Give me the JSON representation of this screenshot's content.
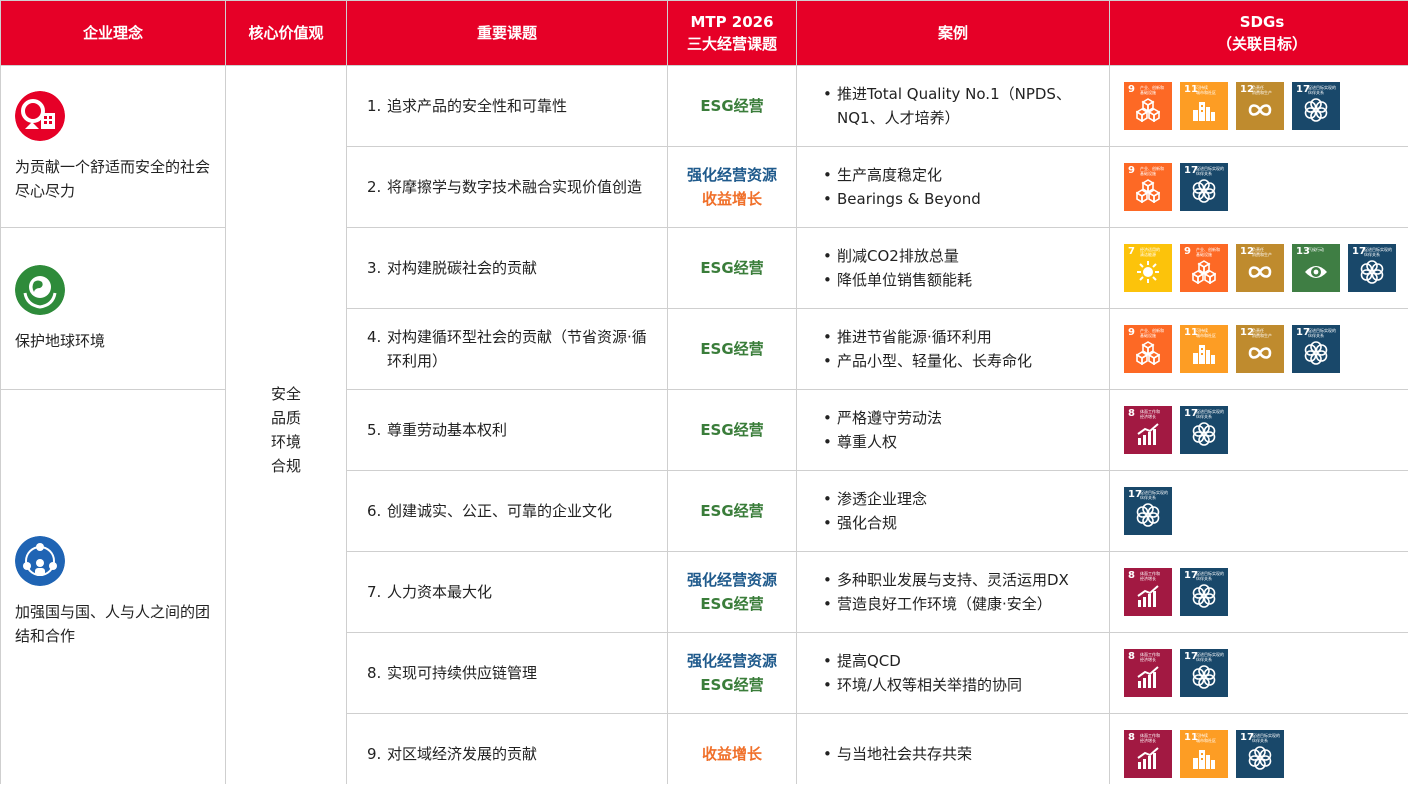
{
  "headers": {
    "philosophy": "企业理念",
    "values": "核心价值观",
    "topics": "重要课题",
    "mtp_line1": "MTP 2026",
    "mtp_line2": "三大经营课题",
    "cases": "案例",
    "sdgs_line1": "SDGs",
    "sdgs_line2": "（关联目标）"
  },
  "philosophies": [
    {
      "text": "为贡献一个舒适而安全的社会尽心尽力",
      "icon": "lifebuoy-house-icon",
      "color": "#e60027"
    },
    {
      "text": "保护地球环境",
      "icon": "earth-hands-icon",
      "color": "#2e8b3a"
    },
    {
      "text": "加强国与国、人与人之间的团结和合作",
      "icon": "people-circle-icon",
      "color": "#1f64b4"
    }
  ],
  "core_values": [
    "安全",
    "品质",
    "环境",
    "合规"
  ],
  "topics": [
    {
      "num": "1.",
      "text": "追求产品的安全性和可靠性",
      "mtp": [
        {
          "label": "ESG经营",
          "color": "green"
        }
      ],
      "cases": [
        "推进Total Quality No.1（NPDS、NQ1、人才培养）"
      ],
      "sdgs": [
        9,
        11,
        12,
        17
      ]
    },
    {
      "num": "2.",
      "text": "将摩擦学与数字技术融合实现价值创造",
      "mtp": [
        {
          "label": "强化经营资源",
          "color": "blue"
        },
        {
          "label": "收益增长",
          "color": "orange"
        }
      ],
      "cases": [
        "生产高度稳定化",
        "Bearings & Beyond"
      ],
      "sdgs": [
        9,
        17
      ]
    },
    {
      "num": "3.",
      "text": "对构建脱碳社会的贡献",
      "mtp": [
        {
          "label": "ESG经营",
          "color": "green"
        }
      ],
      "cases": [
        "削减CO2排放总量",
        "降低单位销售额能耗"
      ],
      "sdgs": [
        7,
        9,
        12,
        13,
        17
      ]
    },
    {
      "num": "4.",
      "text": "对构建循环型社会的贡献（节省资源·循环利用）",
      "mtp": [
        {
          "label": "ESG经营",
          "color": "green"
        }
      ],
      "cases": [
        "推进节省能源·循环利用",
        "产品小型、轻量化、长寿命化"
      ],
      "sdgs": [
        9,
        11,
        12,
        17
      ]
    },
    {
      "num": "5.",
      "text": "尊重劳动基本权利",
      "mtp": [
        {
          "label": "ESG经营",
          "color": "green"
        }
      ],
      "cases": [
        "严格遵守劳动法",
        "尊重人权"
      ],
      "sdgs": [
        8,
        17
      ]
    },
    {
      "num": "6.",
      "text": "创建诚实、公正、可靠的企业文化",
      "mtp": [
        {
          "label": "ESG经营",
          "color": "green"
        }
      ],
      "cases": [
        "渗透企业理念",
        "强化合规"
      ],
      "sdgs": [
        17
      ]
    },
    {
      "num": "7.",
      "text": "人力资本最大化",
      "mtp": [
        {
          "label": "强化经营资源",
          "color": "blue"
        },
        {
          "label": "ESG经营",
          "color": "green"
        }
      ],
      "cases": [
        "多种职业发展与支持、灵活运用DX",
        "营造良好工作环境（健康·安全）"
      ],
      "sdgs": [
        8,
        17
      ]
    },
    {
      "num": "8.",
      "text": "实现可持续供应链管理",
      "mtp": [
        {
          "label": "强化经营资源",
          "color": "blue"
        },
        {
          "label": "ESG经营",
          "color": "green"
        }
      ],
      "cases": [
        "提高QCD",
        "环境/人权等相关举措的协同"
      ],
      "sdgs": [
        8,
        17
      ]
    },
    {
      "num": "9.",
      "text": "对区域经济发展的贡献",
      "mtp": [
        {
          "label": "收益增长",
          "color": "orange"
        }
      ],
      "cases": [
        "与当地社会共存共荣"
      ],
      "sdgs": [
        8,
        11,
        17
      ]
    }
  ],
  "sdg_defs": {
    "7": {
      "color": "#fcc30b",
      "label": "经济适用的\n清洁能源",
      "icon": "sun-icon"
    },
    "8": {
      "color": "#a21942",
      "label": "体面工作和\n经济增长",
      "icon": "growth-chart-icon"
    },
    "9": {
      "color": "#fd6925",
      "label": "产业、创新和\n基础设施",
      "icon": "cubes-icon"
    },
    "11": {
      "color": "#fd9d24",
      "label": "可持续\n城市和社区",
      "icon": "city-icon"
    },
    "12": {
      "color": "#bf8b2e",
      "label": "负责任\n消费和生产",
      "icon": "infinity-icon"
    },
    "13": {
      "color": "#3f7e44",
      "label": "气候行动",
      "icon": "eye-earth-icon"
    },
    "17": {
      "color": "#19486a",
      "label": "促进目标实现的\n伙伴关系",
      "icon": "flower-ring-icon"
    }
  }
}
